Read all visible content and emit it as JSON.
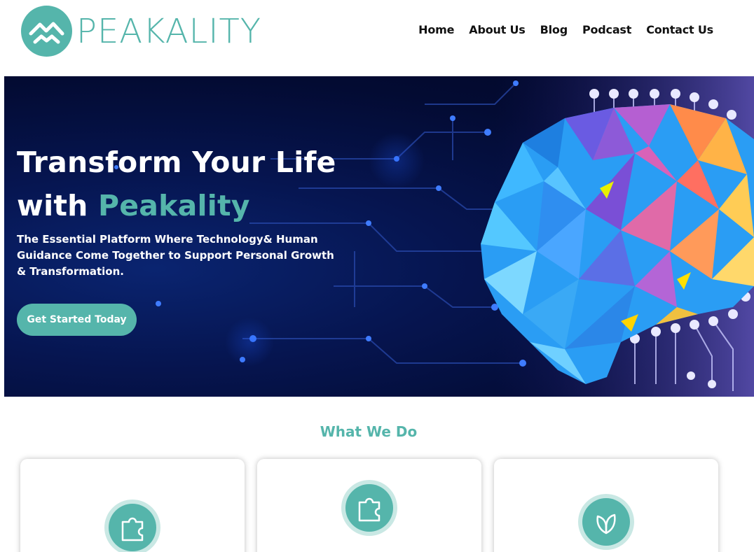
{
  "brand": {
    "name": "PEAKALITY",
    "color": "#55b5ab"
  },
  "nav": {
    "items": [
      "Home",
      "About Us",
      "Blog",
      "Podcast",
      "Contact Us"
    ]
  },
  "hero": {
    "title_line1": "Transform Your Life",
    "title_line2_prefix": "with ",
    "title_line2_accent": "Peakality",
    "subtitle": "The Essential Platform Where Technology& Human Guidance Come Together to Support Personal Growth & Transformation.",
    "cta_label": "Get Started Today"
  },
  "section": {
    "title": "What We Do",
    "cards": [
      {
        "icon": "puzzle-icon"
      },
      {
        "icon": "puzzle-icon"
      },
      {
        "icon": "leaf-icon"
      }
    ]
  }
}
